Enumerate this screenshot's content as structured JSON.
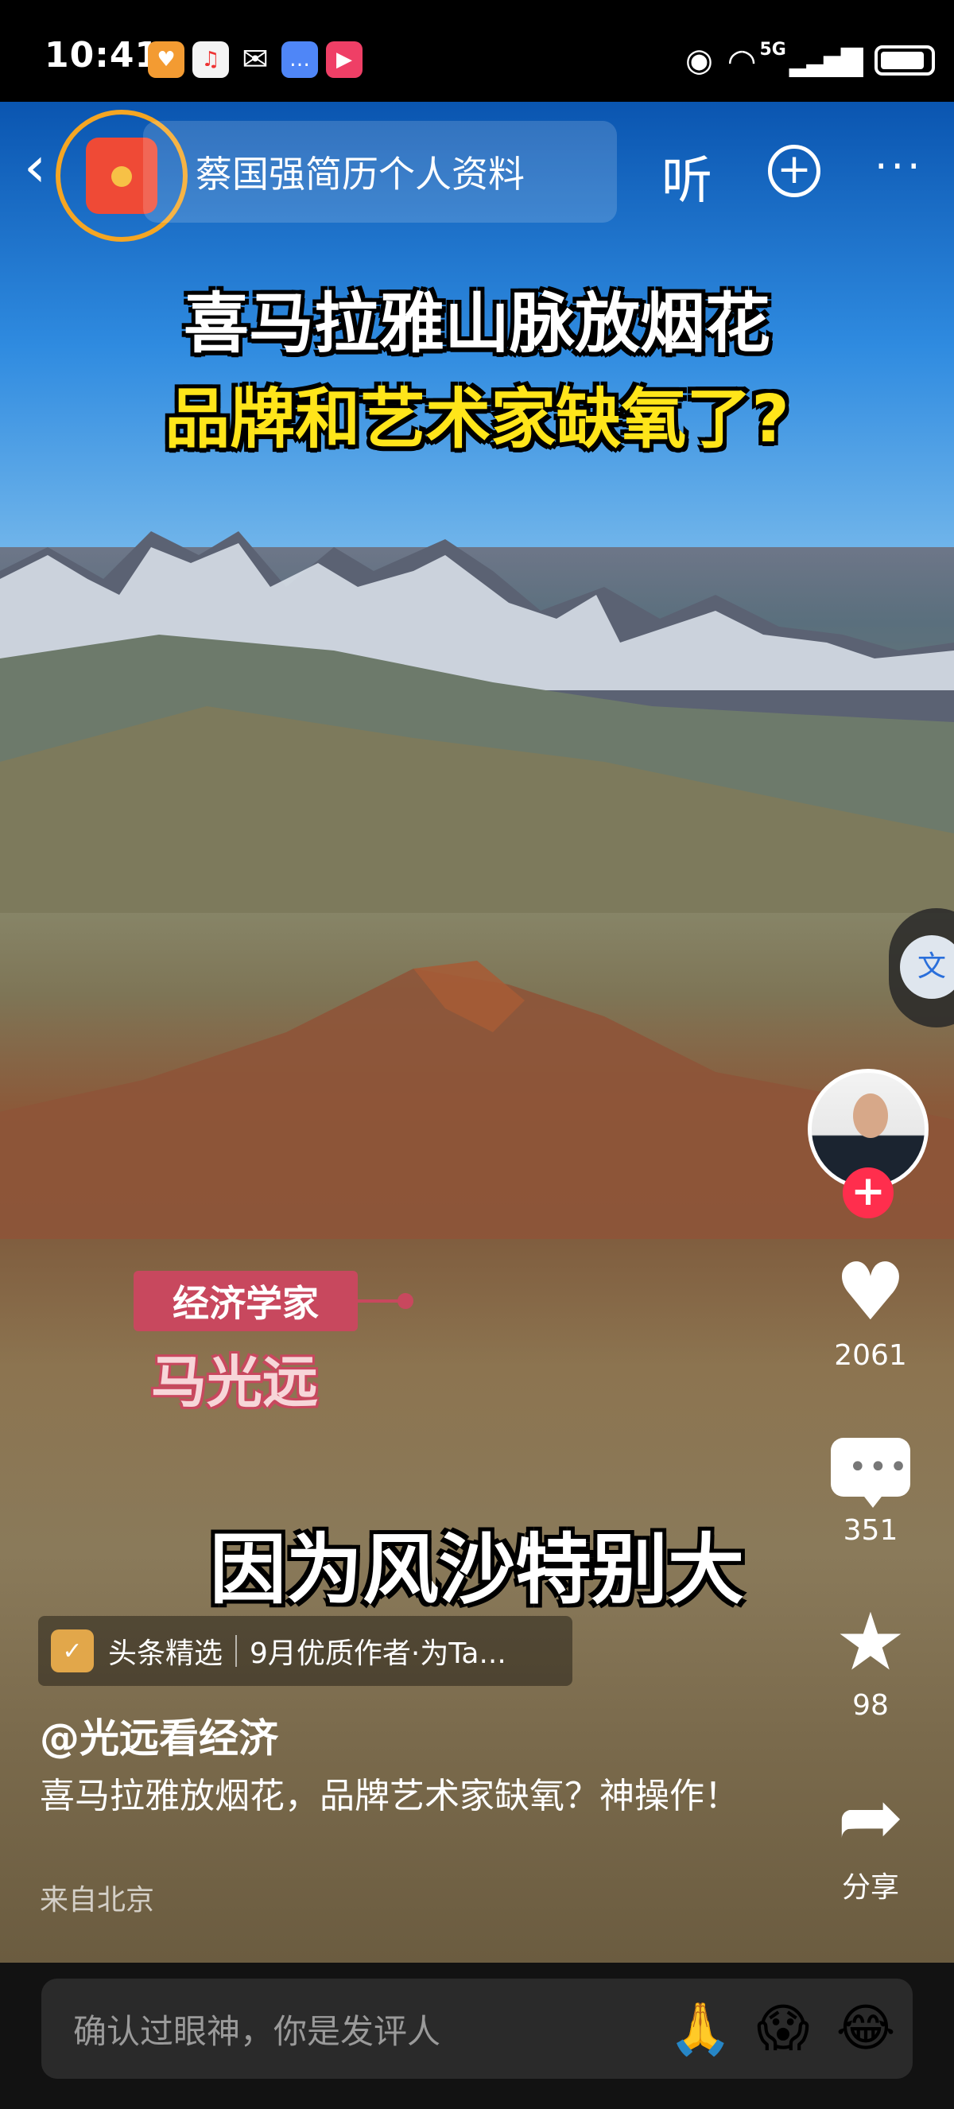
{
  "status_bar": {
    "time": "10:41",
    "network": "5G",
    "notification_icons": [
      "orange-app-icon",
      "music-icon",
      "wechat-icon",
      "message-icon",
      "video-app-icon"
    ]
  },
  "header": {
    "search_text": "蔡国强简历个人资料",
    "listen_label": "听",
    "plus_label": "+",
    "more_label": "···"
  },
  "video": {
    "title_line1": "喜马拉雅山脉放烟花",
    "title_line2": "品牌和艺术家缺氧了?",
    "name_tag_role": "经济学家",
    "name_tag_name": "马光远",
    "subtitle": "因为风沙特别大"
  },
  "rail": {
    "like_count": "2061",
    "comment_count": "351",
    "favorite_count": "98",
    "share_label": "分享"
  },
  "info": {
    "source_logo_text": "✓",
    "source_name": "头条精选",
    "source_note": "9月优质作者·为Ta...",
    "author": "@光远看经济",
    "description": "喜马拉雅放烟花，品牌艺术家缺氧？神操作！",
    "location": "来自北京"
  },
  "comment_bar": {
    "placeholder": "确认过眼神，你是发评人",
    "emojis": [
      "🙏",
      "😱",
      "😂"
    ]
  },
  "colors": {
    "like": "#ffffff",
    "follow": "#ff2e4d",
    "red_packet_ring": "#f5a623",
    "title_yellow": "#ffe51a",
    "tag_pink": "#c8485e"
  }
}
